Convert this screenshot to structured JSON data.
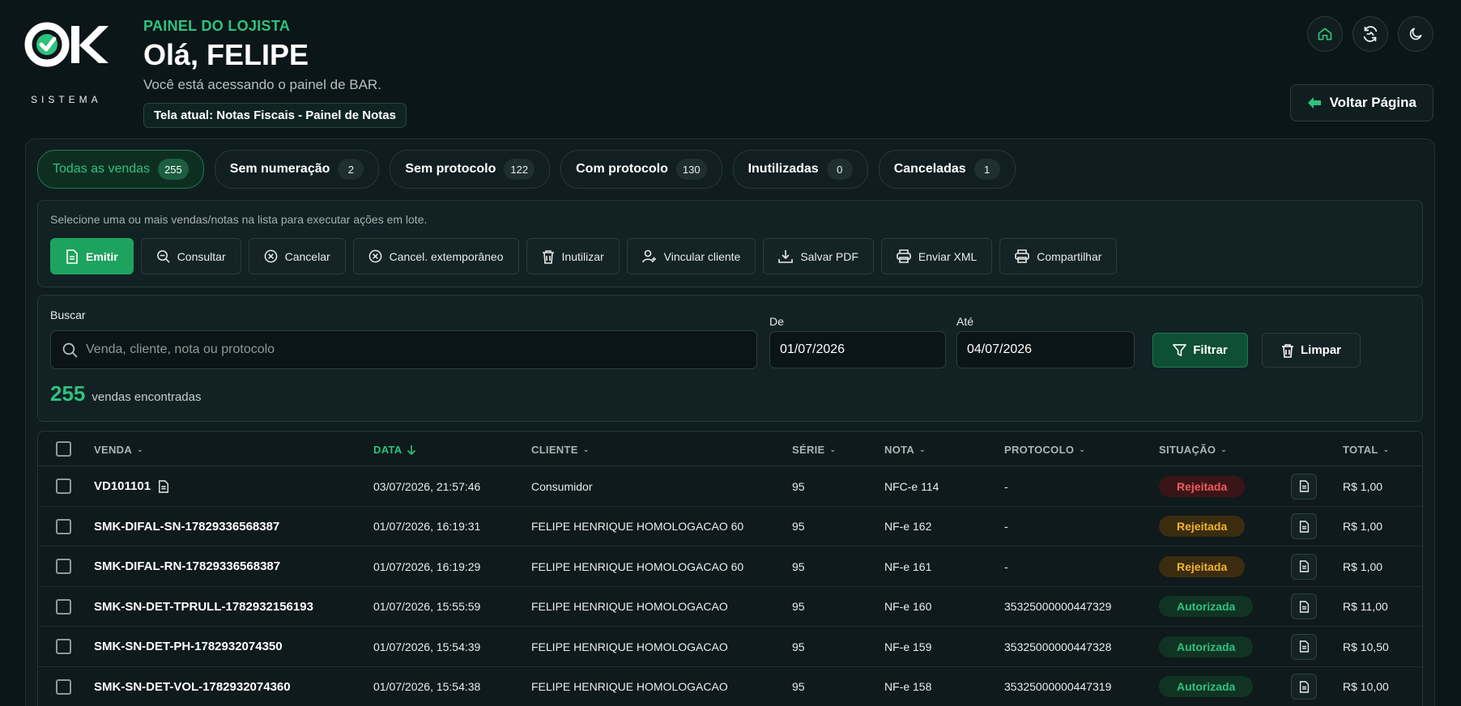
{
  "brand": {
    "logo_text": "OK",
    "logo_sub": "SISTEMA",
    "accent": "#2ec27e"
  },
  "header": {
    "eyebrow": "PAINEL DO LOJISTA",
    "greeting": "Olá, FELIPE",
    "subtitle": "Você está acessando o painel de BAR.",
    "current_screen": "Tela atual: Notas Fiscais - Painel de Notas"
  },
  "top_icons": [
    "home-icon",
    "sync-icon",
    "moon-icon"
  ],
  "back_button": {
    "label": "Voltar Página"
  },
  "tabs": [
    {
      "label": "Todas as vendas",
      "count": "255"
    },
    {
      "label": "Sem numeração",
      "count": "2"
    },
    {
      "label": "Sem protocolo",
      "count": "122"
    },
    {
      "label": "Com protocolo",
      "count": "130"
    },
    {
      "label": "Inutilizadas",
      "count": "0"
    },
    {
      "label": "Canceladas",
      "count": "1"
    }
  ],
  "batch": {
    "hint": "Selecione uma ou mais vendas/notas na lista para executar ações em lote.",
    "actions": [
      {
        "label": "Emitir",
        "icon": "document-icon"
      },
      {
        "label": "Consultar",
        "icon": "search-icon"
      },
      {
        "label": "Cancelar",
        "icon": "cancel-circle-icon"
      },
      {
        "label": "Cancel. extemporâneo",
        "icon": "cancel-circle-icon"
      },
      {
        "label": "Inutilizar",
        "icon": "trash-icon"
      },
      {
        "label": "Vincular cliente",
        "icon": "user-link-icon"
      },
      {
        "label": "Salvar PDF",
        "icon": "download-icon"
      },
      {
        "label": "Enviar XML",
        "icon": "printer-icon"
      },
      {
        "label": "Compartilhar",
        "icon": "share-printer-icon"
      }
    ]
  },
  "search": {
    "label": "Buscar",
    "placeholder": "Venda, cliente, nota ou protocolo",
    "from_label": "De",
    "from_value": "01/07/2026",
    "to_label": "Até",
    "to_value": "04/07/2026",
    "filter_label": "Filtrar",
    "clear_label": "Limpar",
    "result_count": "255",
    "result_text": "vendas encontradas"
  },
  "table": {
    "columns": {
      "venda": "VENDA",
      "data": "DATA",
      "cliente": "CLIENTE",
      "serie": "SÉRIE",
      "nota": "NOTA",
      "protocolo": "PROTOCOLO",
      "situacao": "SITUAÇÃO",
      "total": "TOTAL"
    },
    "rows": [
      {
        "venda": "VD101101",
        "data": "03/07/2026, 21:57:46",
        "cliente": "Consumidor",
        "serie": "95",
        "nota": "NFC-e 114",
        "protocolo": "-",
        "situacao": "Rejeitada",
        "tone": "red",
        "total": "R$ 1,00"
      },
      {
        "venda": "SMK-DIFAL-SN-17829336568387",
        "data": "01/07/2026, 16:19:31",
        "cliente": "FELIPE HENRIQUE HOMOLOGACAO 60",
        "serie": "95",
        "nota": "NF-e 162",
        "protocolo": "-",
        "situacao": "Rejeitada",
        "tone": "amber",
        "total": "R$ 1,00"
      },
      {
        "venda": "SMK-DIFAL-RN-17829336568387",
        "data": "01/07/2026, 16:19:29",
        "cliente": "FELIPE HENRIQUE HOMOLOGACAO 60",
        "serie": "95",
        "nota": "NF-e 161",
        "protocolo": "-",
        "situacao": "Rejeitada",
        "tone": "amber",
        "total": "R$ 1,00"
      },
      {
        "venda": "SMK-SN-DET-TPRULL-1782932156193",
        "data": "01/07/2026, 15:55:59",
        "cliente": "FELIPE HENRIQUE HOMOLOGACAO",
        "serie": "95",
        "nota": "NF-e 160",
        "protocolo": "35325000000447329",
        "situacao": "Autorizada",
        "tone": "green",
        "total": "R$ 11,00"
      },
      {
        "venda": "SMK-SN-DET-PH-1782932074350",
        "data": "01/07/2026, 15:54:39",
        "cliente": "FELIPE HENRIQUE HOMOLOGACAO",
        "serie": "95",
        "nota": "NF-e 159",
        "protocolo": "35325000000447328",
        "situacao": "Autorizada",
        "tone": "green",
        "total": "R$ 10,50"
      },
      {
        "venda": "SMK-SN-DET-VOL-1782932074360",
        "data": "01/07/2026, 15:54:38",
        "cliente": "FELIPE HENRIQUE HOMOLOGACAO",
        "serie": "95",
        "nota": "NF-e 158",
        "protocolo": "35325000000447319",
        "situacao": "Autorizada",
        "tone": "green",
        "total": "R$ 10,00"
      }
    ]
  }
}
